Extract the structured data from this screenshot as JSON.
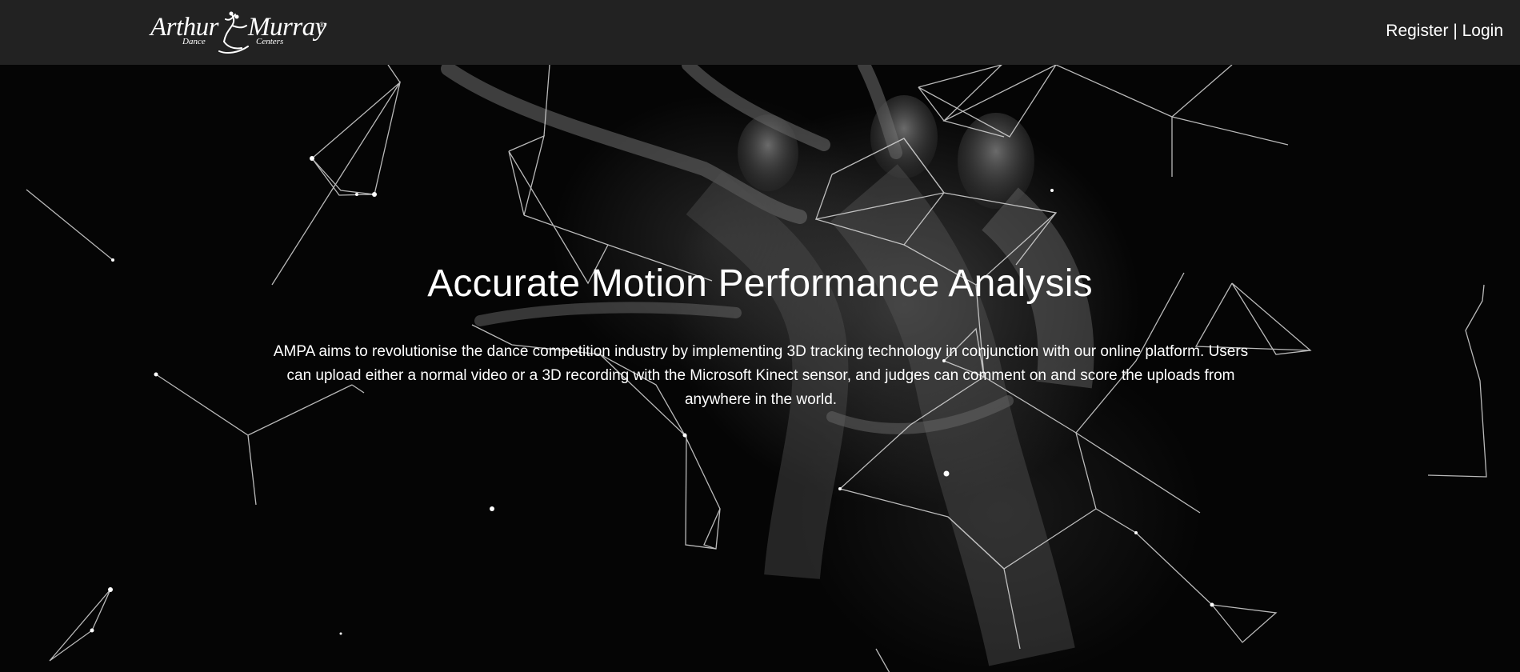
{
  "navbar": {
    "logo": {
      "word_a": "Arthur",
      "word_b": "Murray",
      "registered": "®",
      "sub_a": "Dance",
      "sub_b": "Centers"
    },
    "register_label": "Register",
    "separator": " | ",
    "login_label": "Login"
  },
  "hero": {
    "headline": "Accurate Motion Performance Analysis",
    "description": "AMPA aims to revolutionise the dance competition industry by implementing 3D tracking technology in conjunction with our online platform. Users can upload either a normal video or a 3D recording with the Microsoft Kinect sensor, and judges can comment on and score the uploads from anywhere in the world."
  },
  "colors": {
    "navbar_bg": "#222222",
    "hero_bg": "#050505",
    "text": "#ffffff"
  },
  "icons": [
    "dancer-silhouette-logo-icon",
    "network-lines-decoration"
  ]
}
